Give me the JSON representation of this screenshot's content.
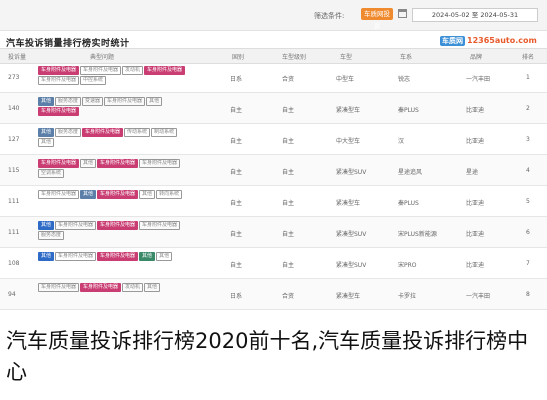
{
  "topbar": {
    "filter_label": "筛选条件:",
    "filter_button": "车质网投诉",
    "date_range": "2024-05-02 至 2024-05-31"
  },
  "title": "汽车投诉销量排行榜实时统计",
  "logo": {
    "badge": "车质网",
    "text": "12365auto.com"
  },
  "columns": [
    "排名",
    "品牌",
    "车系",
    "车型",
    "车型级别",
    "国别",
    "典型问题",
    "投诉量"
  ],
  "rows": [
    {
      "rank": "1",
      "brand": "一汽丰田",
      "series": "锐志",
      "model": "中型车",
      "level": "合资",
      "country": "日系",
      "count": "273",
      "tags": [
        {
          "t": "车身附件及电器",
          "c": "h"
        },
        {
          "t": "车身附件及电器",
          "c": ""
        },
        {
          "t": "发动机",
          "c": ""
        },
        {
          "t": "车身附件及电器",
          "c": "h"
        },
        {
          "t": "车身附件及电器",
          "c": ""
        },
        {
          "t": "中控系统",
          "c": ""
        }
      ]
    },
    {
      "rank": "2",
      "brand": "比亚迪",
      "series": "秦PLUS",
      "model": "紧凑型车",
      "level": "自主",
      "country": "自主",
      "count": "140",
      "tags": [
        {
          "t": "其他",
          "c": "s"
        },
        {
          "t": "服务态度",
          "c": ""
        },
        {
          "t": "变速器",
          "c": ""
        },
        {
          "t": "车身附件及电器",
          "c": ""
        },
        {
          "t": "其他",
          "c": ""
        },
        {
          "t": "车身附件及电器",
          "c": "h"
        }
      ]
    },
    {
      "rank": "3",
      "brand": "比亚迪",
      "series": "汉",
      "model": "中大型车",
      "level": "自主",
      "country": "自主",
      "count": "127",
      "tags": [
        {
          "t": "其他",
          "c": "s"
        },
        {
          "t": "服务态度",
          "c": ""
        },
        {
          "t": "车身附件及电器",
          "c": "h"
        },
        {
          "t": "传动系统",
          "c": ""
        },
        {
          "t": "制动系统",
          "c": ""
        },
        {
          "t": "其他",
          "c": ""
        }
      ]
    },
    {
      "rank": "4",
      "brand": "星途",
      "series": "星途追风",
      "model": "紧凑型SUV",
      "level": "自主",
      "country": "自主",
      "count": "115",
      "tags": [
        {
          "t": "车身附件及电器",
          "c": "h"
        },
        {
          "t": "其他",
          "c": ""
        },
        {
          "t": "车身附件及电器",
          "c": "h"
        },
        {
          "t": "车身附件及电器",
          "c": ""
        },
        {
          "t": "空调系统",
          "c": ""
        }
      ]
    },
    {
      "rank": "5",
      "brand": "比亚迪",
      "series": "秦PLUS",
      "model": "紧凑型车",
      "level": "自主",
      "country": "自主",
      "count": "111",
      "tags": [
        {
          "t": "车身附件及电器",
          "c": ""
        },
        {
          "t": "其他",
          "c": "s"
        },
        {
          "t": "车身附件及电器",
          "c": "h"
        },
        {
          "t": "其他",
          "c": ""
        },
        {
          "t": "转向系统",
          "c": ""
        }
      ]
    },
    {
      "rank": "6",
      "brand": "比亚迪",
      "series": "宋PLUS新能源",
      "model": "紧凑型SUV",
      "level": "自主",
      "country": "自主",
      "count": "111",
      "tags": [
        {
          "t": "其他",
          "c": "b"
        },
        {
          "t": "车身附件及电器",
          "c": ""
        },
        {
          "t": "车身附件及电器",
          "c": "h"
        },
        {
          "t": "车身附件及电器",
          "c": ""
        },
        {
          "t": "服务态度",
          "c": ""
        }
      ]
    },
    {
      "rank": "7",
      "brand": "比亚迪",
      "series": "宋PRO",
      "model": "紧凑型SUV",
      "level": "自主",
      "country": "自主",
      "count": "108",
      "tags": [
        {
          "t": "其他",
          "c": "b"
        },
        {
          "t": "车身附件及电器",
          "c": ""
        },
        {
          "t": "车身附件及电器",
          "c": "h"
        },
        {
          "t": "其他",
          "c": "g"
        },
        {
          "t": "其他",
          "c": ""
        }
      ]
    },
    {
      "rank": "8",
      "brand": "一汽丰田",
      "series": "卡罗拉",
      "model": "紧凑型车",
      "level": "合资",
      "country": "日系",
      "count": "94",
      "tags": [
        {
          "t": "车身附件及电器",
          "c": ""
        },
        {
          "t": "车身附件及电器",
          "c": "h"
        },
        {
          "t": "发动机",
          "c": ""
        },
        {
          "t": "其他",
          "c": ""
        }
      ]
    }
  ],
  "caption": "汽车质量投诉排行榜2020前十名,汽车质量投诉排行榜中心"
}
